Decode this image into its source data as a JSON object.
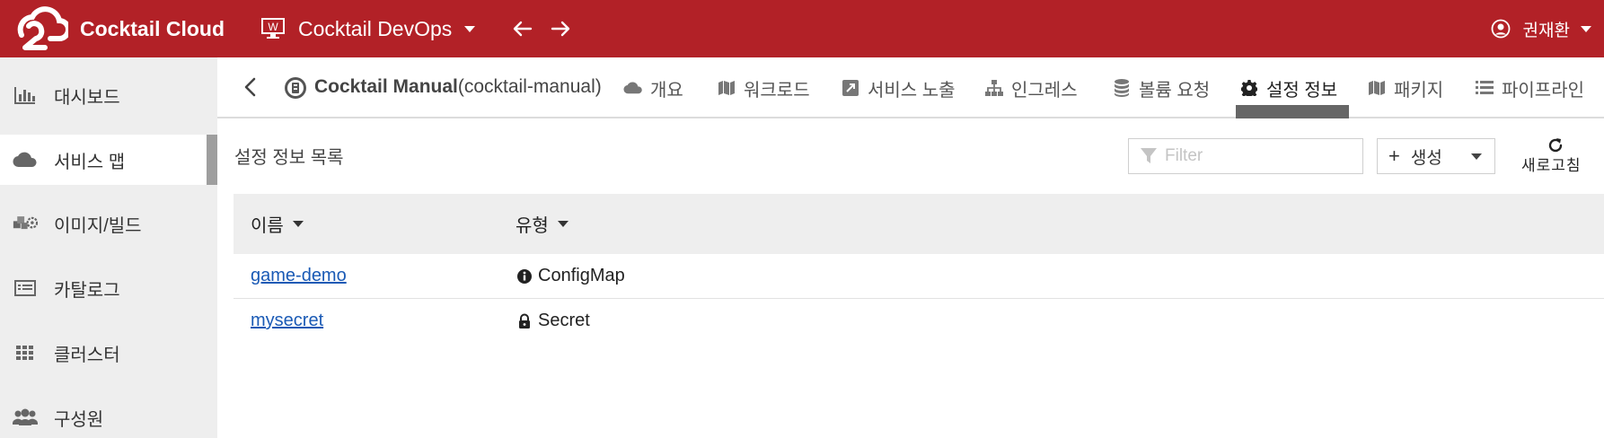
{
  "header": {
    "brand": "Cocktail Cloud",
    "workspace": "Cocktail DevOps",
    "workspace_icon_letter": "W",
    "user": "권재환",
    "accent": "#b22127"
  },
  "sidebar": {
    "items": [
      {
        "label": "대시보드",
        "icon": "bar-chart-icon"
      },
      {
        "label": "서비스 맵",
        "icon": "cloud-icon",
        "active": true
      },
      {
        "label": "이미지/빌드",
        "icon": "cubes-gear-icon"
      },
      {
        "label": "카탈로그",
        "icon": "list-alt-icon"
      },
      {
        "label": "클러스터",
        "icon": "grid-icon"
      },
      {
        "label": "구성원",
        "icon": "users-icon"
      }
    ]
  },
  "service": {
    "name": "Cocktail Manual",
    "id": "(cocktail-manual)"
  },
  "tabs": [
    {
      "label": "개요",
      "icon": "cloud-icon"
    },
    {
      "label": "워크로드",
      "icon": "map-icon"
    },
    {
      "label": "서비스 노출",
      "icon": "external-link-icon"
    },
    {
      "label": "인그레스",
      "icon": "sitemap-icon"
    },
    {
      "label": "볼륨 요청",
      "icon": "database-icon"
    },
    {
      "label": "설정 정보",
      "icon": "gear-icon",
      "active": true
    },
    {
      "label": "패키지",
      "icon": "map-icon"
    },
    {
      "label": "파이프라인",
      "icon": "list-icon"
    }
  ],
  "content": {
    "title": "설정 정보 목록",
    "filter_placeholder": "Filter",
    "create_label": "생성",
    "refresh_label": "새로고침"
  },
  "table": {
    "columns": [
      "이름",
      "유형"
    ],
    "rows": [
      {
        "name": "game-demo",
        "type": "ConfigMap",
        "type_icon": "info-circle-icon"
      },
      {
        "name": "mysecret",
        "type": "Secret",
        "type_icon": "lock-icon"
      }
    ]
  }
}
